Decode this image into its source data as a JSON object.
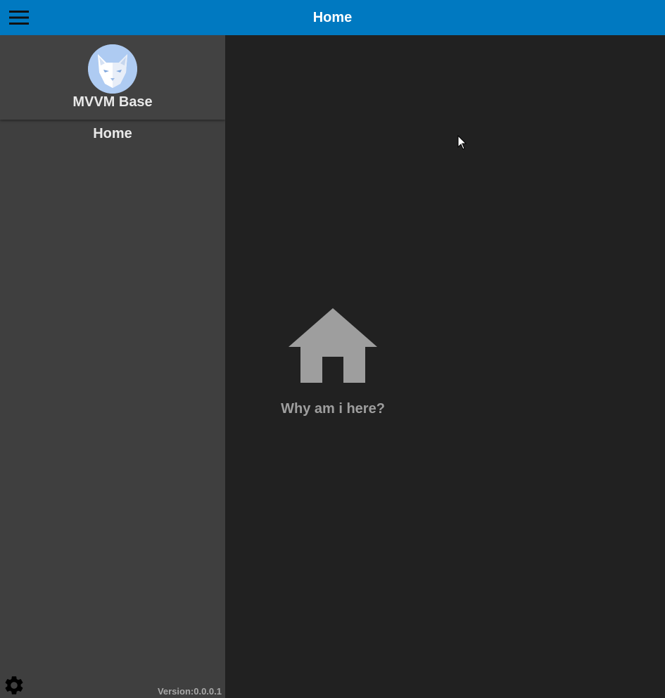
{
  "topbar": {
    "title": "Home",
    "menu_icon": "hamburger-menu-icon",
    "background": "#0079C1"
  },
  "sidebar": {
    "app_name": "MVVM Base",
    "avatar_icon": "cat-logo",
    "nav_items": [
      {
        "label": "Home"
      }
    ],
    "settings_icon": "gear-icon",
    "version": "Version:0.0.0.1",
    "background": "#3F3F3F"
  },
  "content": {
    "icon": "home-icon",
    "message": "Why am i here?",
    "background": "#212121"
  }
}
